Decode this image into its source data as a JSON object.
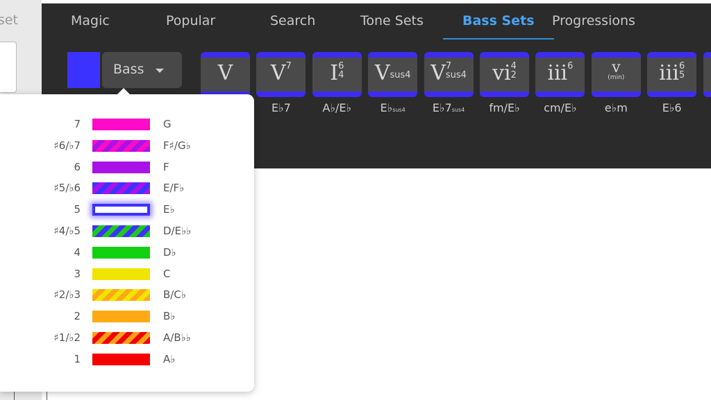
{
  "left_panel": {
    "preset_label_partial": "set"
  },
  "tabs": [
    {
      "label": "Magic"
    },
    {
      "label": "Popular"
    },
    {
      "label": "Search"
    },
    {
      "label": "Tone Sets"
    },
    {
      "label": "Bass Sets",
      "active": true
    },
    {
      "label": "Progressions"
    }
  ],
  "bass_dropdown": {
    "value": "Bass",
    "swatch_color": "#3c32ff"
  },
  "accent_color": "#3d2cf0",
  "chords": [
    {
      "num": "V",
      "sup": "",
      "sub": "",
      "name": "",
      "name_small": ""
    },
    {
      "num": "V",
      "sup": "7",
      "sub": "",
      "name": "E♭7",
      "name_small": ""
    },
    {
      "num": "I",
      "sup": "6",
      "sub": "4",
      "name": "A♭/E♭",
      "name_small": ""
    },
    {
      "num": "V",
      "sup": "",
      "sub": "sus4",
      "name": "E♭",
      "name_small": "sus4"
    },
    {
      "num": "V",
      "sup": "7",
      "sub": "sus4",
      "name": "E♭7",
      "name_small": "sus4"
    },
    {
      "num": "vi",
      "sup": "4",
      "sub": "2",
      "name": "fm/E♭",
      "name_small": ""
    },
    {
      "num": "iii",
      "sup": "6",
      "sub": "",
      "name": "cm/E♭",
      "name_small": ""
    },
    {
      "num": "v",
      "min": "(min)",
      "name": "e♭m",
      "name_small": ""
    },
    {
      "num": "iii",
      "sup": "6",
      "sub": "5",
      "name": "E♭6",
      "name_small": ""
    }
  ],
  "legend": [
    {
      "degree": "7",
      "note": "G",
      "colors": [
        "#ff0ac8"
      ]
    },
    {
      "degree": "♯6/♭7",
      "note": "F♯/G♭",
      "colors": [
        "#ff0ac8",
        "#a912e6"
      ]
    },
    {
      "degree": "6",
      "note": "F",
      "colors": [
        "#a912e6"
      ]
    },
    {
      "degree": "♯5/♭6",
      "note": "E/F♭",
      "colors": [
        "#3c32ff",
        "#a912e6"
      ]
    },
    {
      "degree": "5",
      "note": "E♭",
      "colors": [
        "#3c32ff"
      ],
      "selected": true
    },
    {
      "degree": "♯4/♭5",
      "note": "D/E♭♭",
      "colors": [
        "#3c32ff",
        "#1ec81e"
      ]
    },
    {
      "degree": "4",
      "note": "D♭",
      "colors": [
        "#12d012"
      ]
    },
    {
      "degree": "3",
      "note": "C",
      "colors": [
        "#f0e400"
      ]
    },
    {
      "degree": "♯2/♭3",
      "note": "B/C♭",
      "colors": [
        "#f0e400",
        "#ffa814"
      ]
    },
    {
      "degree": "2",
      "note": "B♭",
      "colors": [
        "#ffaa14"
      ]
    },
    {
      "degree": "♯1/♭2",
      "note": "A/B♭♭",
      "colors": [
        "#ffa014",
        "#f00000"
      ]
    },
    {
      "degree": "1",
      "note": "A♭",
      "colors": [
        "#f50000"
      ]
    }
  ]
}
